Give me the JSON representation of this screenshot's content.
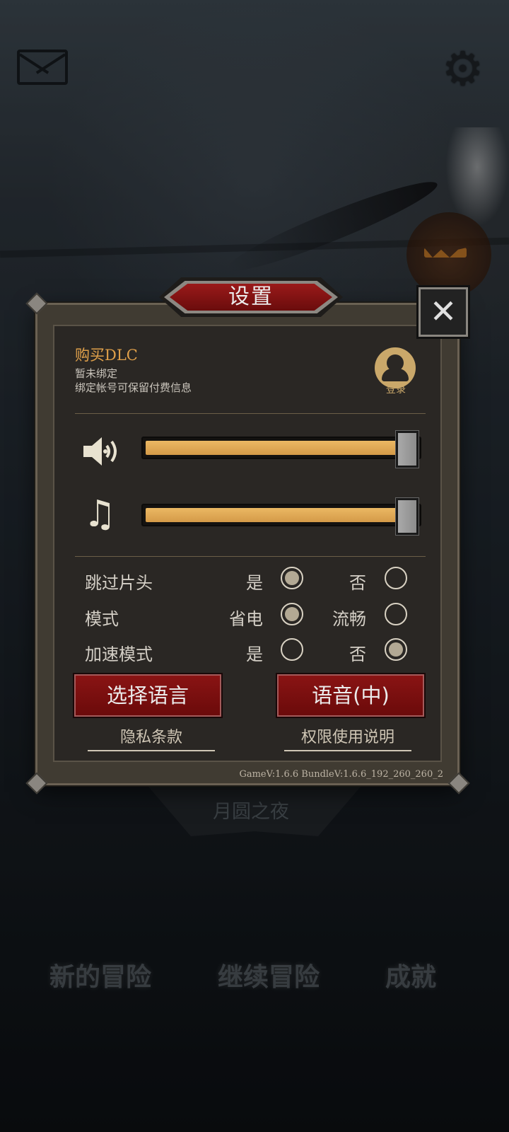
{
  "settings_panel": {
    "title": "设置",
    "close_label": "✕",
    "dlc": {
      "title": "购买DLC",
      "status": "暂未绑定",
      "hint": "绑定帐号可保留付费信息",
      "login_label": "登录"
    },
    "sound_volume": 1.0,
    "music_volume": 1.0,
    "options": [
      {
        "label": "跳过片头",
        "choice_a": "是",
        "choice_b": "否",
        "selected": "a"
      },
      {
        "label": "模式",
        "choice_a": "省电",
        "choice_b": "流畅",
        "selected": "a"
      },
      {
        "label": "加速模式",
        "choice_a": "是",
        "choice_b": "否",
        "selected": "b"
      }
    ],
    "language_button": "选择语言",
    "voice_button": "语音(中)",
    "privacy_link": "隐私条款",
    "permissions_link": "权限使用说明",
    "version": "GameV:1.6.6 BundleV:1.6.6_192_260_260_2"
  },
  "background": {
    "subtitle": "月圆之夜",
    "menu": [
      "新的冒险",
      "继续冒险",
      "成就"
    ]
  },
  "colors": {
    "accent_gold": "#e0a04a",
    "button_red": "#8a1414",
    "slider_fill": "#ebb863"
  }
}
